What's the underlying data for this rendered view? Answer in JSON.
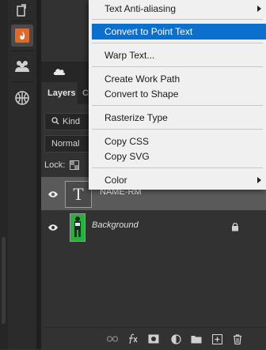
{
  "menu": {
    "text_anti_aliasing": "Text Anti-aliasing",
    "convert_to_point_text": "Convert to Point Text",
    "warp_text": "Warp Text...",
    "create_work_path": "Create Work Path",
    "convert_to_shape": "Convert to Shape",
    "rasterize_type": "Rasterize Type",
    "copy_css": "Copy CSS",
    "copy_svg": "Copy SVG",
    "color": "Color"
  },
  "layers_panel": {
    "tab_layers": "Layers",
    "tab_next_partial": "C",
    "filter_kind": "Kind",
    "blend_mode": "Normal",
    "lock_label": "Lock:"
  },
  "layers": [
    {
      "name": "NAME-RM",
      "thumb_glyph": "T",
      "selected": true
    },
    {
      "name": "Background",
      "italic": true,
      "locked": true
    }
  ],
  "icons": {
    "tools": [
      "history-icon",
      "flame-icon",
      "people-icon",
      "basketball-icon"
    ],
    "footer": [
      "link-layers-icon",
      "fx-icon",
      "layer-mask-icon",
      "adjustment-layer-icon",
      "new-group-icon",
      "new-layer-icon",
      "trash-icon"
    ]
  },
  "colors": {
    "menu_highlight": "#0b6fce",
    "active_tool": "#e06a2c",
    "panel_bg": "#323232"
  }
}
